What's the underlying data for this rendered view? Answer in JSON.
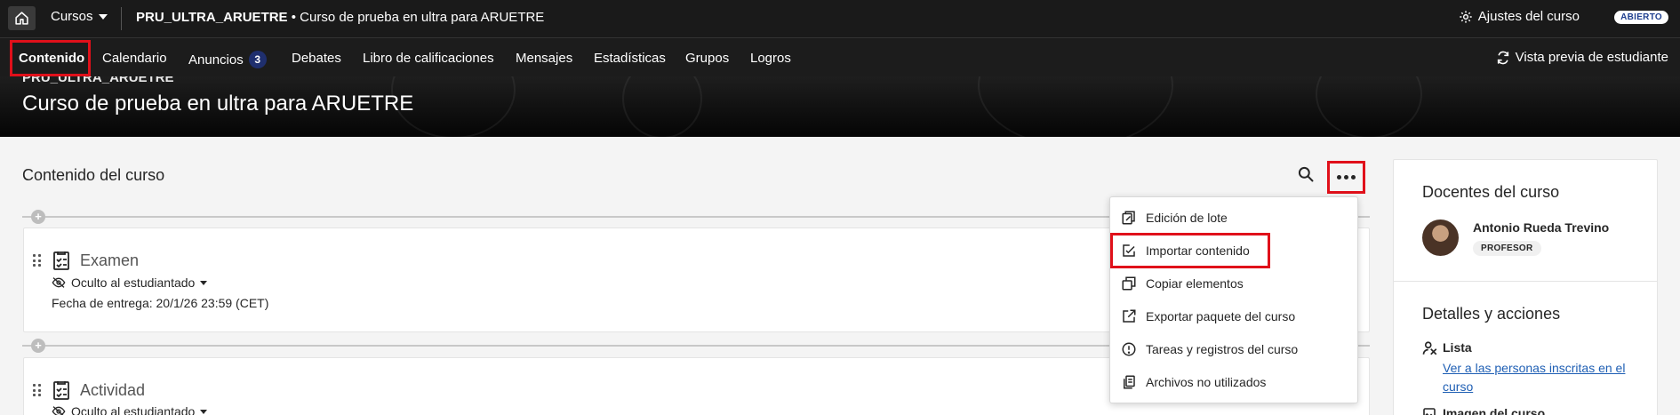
{
  "topbar": {
    "home_icon": "home-icon",
    "courses_label": "Cursos",
    "course_code": "PRU_ULTRA_ARUETRE",
    "course_separator": " • ",
    "course_name": "Curso de prueba en ultra para ARUETRE",
    "settings_label": "Ajustes del curso",
    "status_badge": "ABIERTO"
  },
  "nav": {
    "tabs": [
      {
        "label": "Contenido",
        "active": true
      },
      {
        "label": "Calendario"
      },
      {
        "label": "Anuncios",
        "badge": "3"
      },
      {
        "label": "Debates"
      },
      {
        "label": "Libro de calificaciones"
      },
      {
        "label": "Mensajes"
      },
      {
        "label": "Estadísticas"
      },
      {
        "label": "Grupos"
      },
      {
        "label": "Logros"
      }
    ],
    "student_preview_label": "Vista previa de estudiante"
  },
  "banner": {
    "course_code": "PRU_ULTRA_ARUETRE",
    "course_title": "Curso de prueba en ultra para ARUETRE"
  },
  "content": {
    "title": "Contenido del curso",
    "items": [
      {
        "title": "Examen",
        "visibility": "Oculto al estudiantado",
        "due_date": "Fecha de entrega: 20/1/26 23:59 (CET)"
      },
      {
        "title": "Actividad",
        "visibility": "Oculto al estudiantado"
      }
    ]
  },
  "menu": {
    "items": [
      {
        "label": "Edición de lote",
        "icon": "batch-edit-icon"
      },
      {
        "label": "Importar contenido",
        "icon": "import-content-icon",
        "highlighted": true
      },
      {
        "label": "Copiar elementos",
        "icon": "copy-items-icon"
      },
      {
        "label": "Exportar paquete del curso",
        "icon": "export-package-icon"
      },
      {
        "label": "Tareas y registros del curso",
        "icon": "tasks-logs-icon"
      },
      {
        "label": "Archivos no utilizados",
        "icon": "unused-files-icon"
      }
    ]
  },
  "panel": {
    "instructors_title": "Docentes del curso",
    "instructor_name": "Antonio Rueda Trevino",
    "instructor_role": "PROFESOR",
    "details_title": "Detalles y acciones",
    "list_label": "Lista",
    "list_link": "Ver a las personas inscritas en el curso",
    "course_image_label": "Imagen del curso"
  },
  "colors": {
    "highlight_border": "#e0101a",
    "link": "#1f5fb4",
    "topbar_bg": "#1a1a1a",
    "badge_navy": "#1f2f6e"
  }
}
